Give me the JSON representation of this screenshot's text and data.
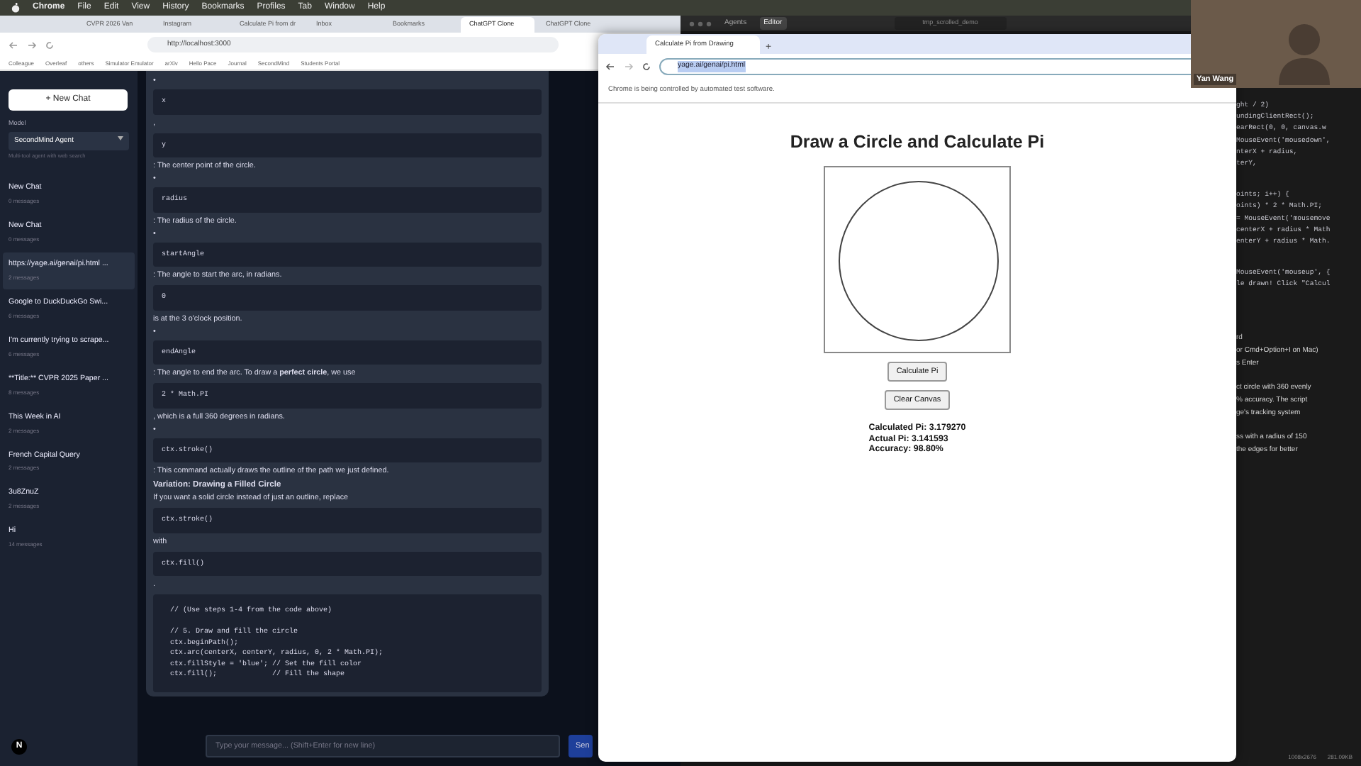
{
  "menu_bar": {
    "items": [
      "Chrome",
      "File",
      "Edit",
      "View",
      "History",
      "Bookmarks",
      "Profiles",
      "Tab",
      "Window",
      "Help"
    ]
  },
  "back_browser": {
    "tabs": [
      {
        "label": "CVPR 2026 Van",
        "selected": false
      },
      {
        "label": "Instagram",
        "selected": false
      },
      {
        "label": "Calculate Pi from dr",
        "selected": false
      },
      {
        "label": "Inbox",
        "selected": false
      },
      {
        "label": "Bookmarks",
        "selected": false
      },
      {
        "label": "ChatGPT Clone",
        "selected": true
      },
      {
        "label": "ChatGPT Clone",
        "selected": false
      }
    ],
    "url": "http://localhost:3000",
    "bookmarks": [
      "Colleague",
      "Overleaf",
      "others",
      "Simulator Emulator",
      "arXiv",
      "Hello Pace",
      "Journal",
      "SecondMind",
      "Students Portal"
    ]
  },
  "chat_app": {
    "new_chat_button": "+ New Chat",
    "model_label": "Model",
    "model_select": "SecondMind Agent",
    "model_hint": "Multi-tool agent with web search",
    "chats": [
      {
        "title": "New Chat",
        "count": "0 messages",
        "selected": false
      },
      {
        "title": "New Chat",
        "count": "0 messages",
        "selected": false
      },
      {
        "title": "https://yage.ai/genai/pi.html ...",
        "count": "2 messages",
        "selected": true
      },
      {
        "title": "Google to DuckDuckGo Swi...",
        "count": "6 messages",
        "selected": false
      },
      {
        "title": "I'm currently trying to scrape...",
        "count": "6 messages",
        "selected": false
      },
      {
        "title": "**Title:** CVPR 2025 Paper ...",
        "count": "8 messages",
        "selected": false
      },
      {
        "title": "This Week in AI",
        "count": "2 messages",
        "selected": false
      },
      {
        "title": "French Capital Query",
        "count": "2 messages",
        "selected": false
      },
      {
        "title": "3u8ZnuZ",
        "count": "2 messages",
        "selected": false
      },
      {
        "title": "Hi",
        "count": "14 messages",
        "selected": false
      }
    ],
    "message_blocks": [
      {
        "kind": "bullet",
        "text": "•"
      },
      {
        "kind": "code",
        "text": "x"
      },
      {
        "kind": "text",
        "text": ","
      },
      {
        "kind": "code",
        "text": "y"
      },
      {
        "kind": "text",
        "text": ": The center point of the circle."
      },
      {
        "kind": "bullet",
        "text": "•"
      },
      {
        "kind": "code",
        "text": "radius"
      },
      {
        "kind": "text",
        "text": ": The radius of the circle."
      },
      {
        "kind": "bullet",
        "text": "•"
      },
      {
        "kind": "code",
        "text": "startAngle"
      },
      {
        "kind": "text",
        "text": ": The angle to start the arc, in radians."
      },
      {
        "kind": "code",
        "text": "0"
      },
      {
        "kind": "text",
        "text": "is at the 3 o'clock position."
      },
      {
        "kind": "bullet",
        "text": "•"
      },
      {
        "kind": "code",
        "text": "endAngle"
      },
      {
        "kind": "text",
        "text": ": The angle to end the arc. To draw a **perfect circle**, we use"
      },
      {
        "kind": "code",
        "text": "2 * Math.PI"
      },
      {
        "kind": "text",
        "text": ", which is a full 360 degrees in radians."
      },
      {
        "kind": "bullet",
        "text": "•"
      },
      {
        "kind": "code",
        "text": "ctx.stroke()"
      },
      {
        "kind": "text",
        "text": ": This command actually draws the outline of the path we just defined."
      },
      {
        "kind": "heading",
        "text": "Variation: Drawing a Filled Circle"
      },
      {
        "kind": "text",
        "text": "If you want a solid circle instead of just an outline, replace"
      },
      {
        "kind": "code",
        "text": "ctx.stroke()"
      },
      {
        "kind": "text",
        "text": "with"
      },
      {
        "kind": "code",
        "text": "ctx.fill()"
      },
      {
        "kind": "text",
        "text": "."
      },
      {
        "kind": "codeblock",
        "text": "// (Use steps 1-4 from the code above)\n\n// 5. Draw and fill the circle\nctx.beginPath();\nctx.arc(centerX, centerY, radius, 0, 2 * Math.PI);\nctx.fillStyle = 'blue'; // Set the fill color\nctx.fill();             // Fill the shape"
      }
    ],
    "input_placeholder": "Type your message... (Shift+Enter for new line)",
    "send_button": "Sen",
    "dev_badge": "N"
  },
  "editor_window": {
    "tabs": [
      {
        "label": "Agents",
        "selected": false
      },
      {
        "label": "Editor",
        "selected": true
      }
    ],
    "search": "tmp_scrolled_demo",
    "code_lines": [
      "ght / 2)",
      "undingClientRect();",
      "earRect(0, 0, canvas.w",
      "MouseEvent('mousedown',",
      "nterX + radius,",
      "terY,",
      "oints; i++) {",
      "oints) * 2 * Math.PI;",
      "= MouseEvent('mousemove",
      "centerX + radius * Math",
      "enterY + radius * Math.",
      "MouseEvent('mouseup', {",
      "le drawn! Click \"Calcul"
    ],
    "chat_lines": [
      "rd",
      "or Cmd+Option+I on Mac)",
      "s Enter",
      "ct circle with 360 evenly",
      "% accuracy. The script",
      "ge's tracking system",
      "ss with a radius of 150",
      "the edges for better"
    ],
    "status": [
      "1008x2676",
      "281.09KB"
    ]
  },
  "webcam": {
    "name": "Yan Wang"
  },
  "front_browser": {
    "tab": "Calculate Pi from Drawing",
    "new_tab": "+",
    "url": "yage.ai/genai/pi.html",
    "infobar": "Chrome is being controlled by automated test software.",
    "page": {
      "title": "Draw a Circle and Calculate Pi",
      "buttons": [
        "Calculate Pi",
        "Clear Canvas"
      ],
      "results": [
        "Calculated Pi: 3.179270",
        "Actual Pi: 3.141593",
        "Accuracy: 98.80%"
      ]
    }
  }
}
